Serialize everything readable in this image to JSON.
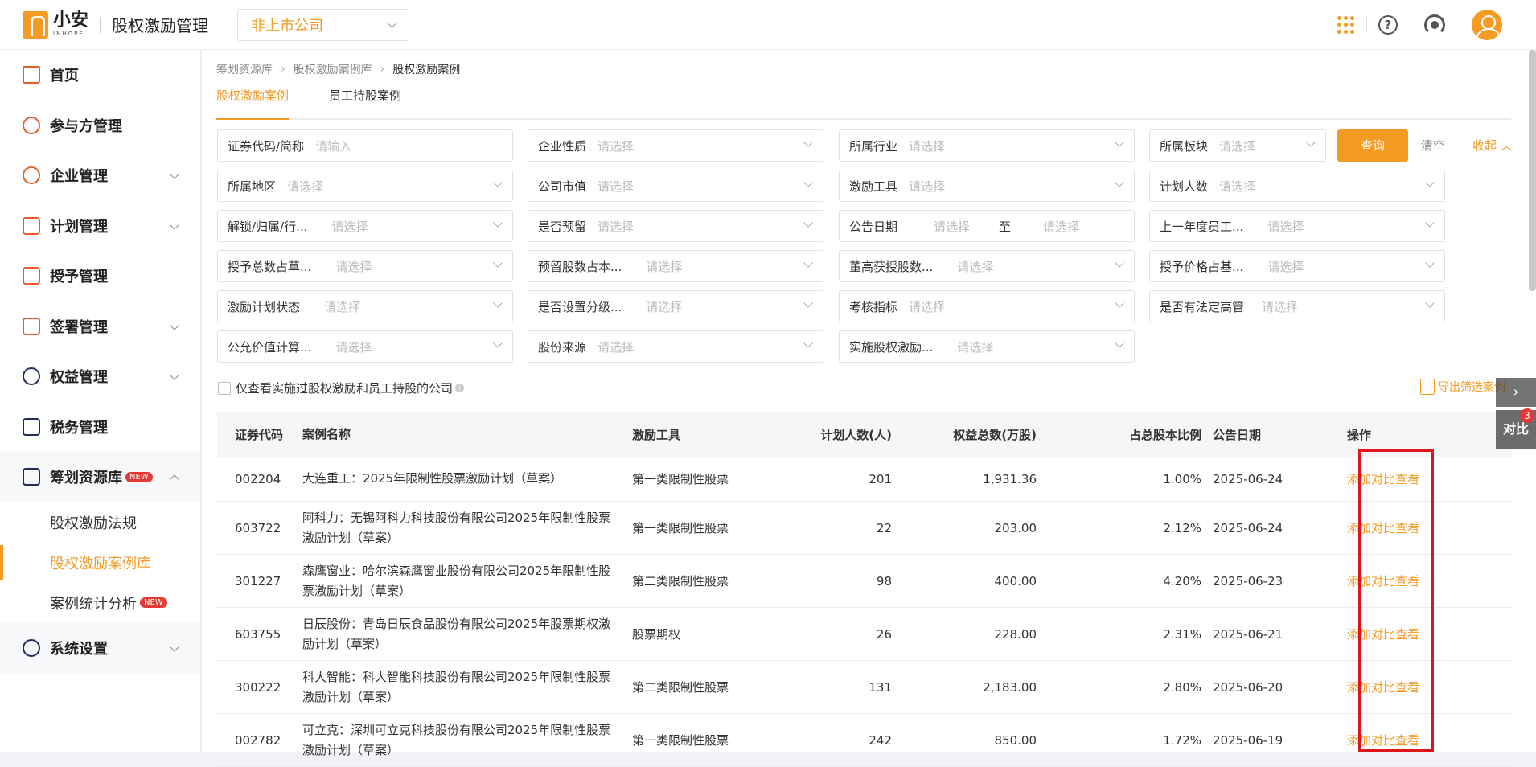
{
  "app": {
    "logo_cn": "小安",
    "logo_en": "INHOPE",
    "title": "股权激励管理",
    "company_select": "非上市公司"
  },
  "sidebar": {
    "items": [
      {
        "label": "首页"
      },
      {
        "label": "参与方管理"
      },
      {
        "label": "企业管理"
      },
      {
        "label": "计划管理"
      },
      {
        "label": "授予管理"
      },
      {
        "label": "签署管理"
      },
      {
        "label": "权益管理"
      },
      {
        "label": "税务管理"
      },
      {
        "label": "筹划资源库",
        "badge": "NEW"
      },
      {
        "label": "系统设置"
      }
    ],
    "sub_items": [
      {
        "label": "股权激励法规"
      },
      {
        "label": "股权激励案例库"
      },
      {
        "label": "案例统计分析",
        "badge": "NEW"
      }
    ]
  },
  "breadcrumb": [
    "筹划资源库",
    "股权激励案例库",
    "股权激励案例"
  ],
  "tabs": [
    {
      "label": "股权激励案例"
    },
    {
      "label": "员工持股案例"
    }
  ],
  "filters": [
    {
      "label": "证券代码/简称",
      "value": "请输入"
    },
    {
      "label": "企业性质",
      "value": "请选择"
    },
    {
      "label": "所属行业",
      "value": "请选择"
    },
    {
      "label": "所属板块",
      "value": "请选择"
    },
    {
      "label": "所属地区",
      "value": "请选择"
    },
    {
      "label": "公司市值",
      "value": "请选择"
    },
    {
      "label": "激励工具",
      "value": "请选择"
    },
    {
      "label": "计划人数",
      "value": "请选择"
    },
    {
      "label": "解锁/归属/行...",
      "value": "请选择"
    },
    {
      "label": "是否预留",
      "value": "请选择"
    },
    {
      "label": "公告日期",
      "value": "请选择",
      "to": "至",
      "value2": "请选择"
    },
    {
      "label": "上一年度员工...",
      "value": "请选择"
    },
    {
      "label": "授予总数占草...",
      "value": "请选择"
    },
    {
      "label": "预留股数占本...",
      "value": "请选择"
    },
    {
      "label": "董高获授股数...",
      "value": "请选择"
    },
    {
      "label": "授予价格占基...",
      "value": "请选择"
    },
    {
      "label": "激励计划状态",
      "value": "请选择"
    },
    {
      "label": "是否设置分级...",
      "value": "请选择"
    },
    {
      "label": "考核指标",
      "value": "请选择"
    },
    {
      "label": "是否有法定高管",
      "value": "请选择"
    },
    {
      "label": "公允价值计算...",
      "value": "请选择"
    },
    {
      "label": "股份来源",
      "value": "请选择"
    },
    {
      "label": "实施股权激励...",
      "value": "请选择"
    }
  ],
  "actions": {
    "query": "查询",
    "clear": "清空",
    "collapse": "收起",
    "checkbox_label": "仅查看实施过股权激励和员工持股的公司",
    "export": "导出筛选案例"
  },
  "table": {
    "headers": [
      "证券代码",
      "案例名称",
      "激励工具",
      "计划人数(人)",
      "权益总数(万股)",
      "占总股本比例",
      "公告日期",
      "操作"
    ],
    "op_add": "添加对比",
    "op_view": "查看",
    "rows": [
      {
        "code": "002204",
        "name": "大连重工：2025年限制性股票激励计划（草案）",
        "tool": "第一类限制性股票",
        "count": "201",
        "total": "1,931.36",
        "ratio": "1.00%",
        "date": "2025-06-24"
      },
      {
        "code": "603722",
        "name": "阿科力：无锡阿科力科技股份有限公司2025年限制性股票激励计划（草案）",
        "tool": "第一类限制性股票",
        "count": "22",
        "total": "203.00",
        "ratio": "2.12%",
        "date": "2025-06-24"
      },
      {
        "code": "301227",
        "name": "森鹰窗业：哈尔滨森鹰窗业股份有限公司2025年限制性股票激励计划（草案）",
        "tool": "第二类限制性股票",
        "count": "98",
        "total": "400.00",
        "ratio": "4.20%",
        "date": "2025-06-23"
      },
      {
        "code": "603755",
        "name": "日辰股份：青岛日辰食品股份有限公司2025年股票期权激励计划（草案）",
        "tool": "股票期权",
        "count": "26",
        "total": "228.00",
        "ratio": "2.31%",
        "date": "2025-06-21"
      },
      {
        "code": "300222",
        "name": "科大智能：科大智能科技股份有限公司2025年限制性股票激励计划（草案）",
        "tool": "第二类限制性股票",
        "count": "131",
        "total": "2,183.00",
        "ratio": "2.80%",
        "date": "2025-06-20"
      },
      {
        "code": "002782",
        "name": "可立克：深圳可立克科技股份有限公司2025年限制性股票激励计划（草案）",
        "tool": "第一类限制性股票",
        "count": "242",
        "total": "850.00",
        "ratio": "1.72%",
        "date": "2025-06-19"
      }
    ]
  },
  "float": {
    "expand": "›",
    "compare": "对比",
    "compare_count": "3"
  },
  "colors": {
    "accent": "#f59a23",
    "highlight_box": "#e0151b"
  }
}
